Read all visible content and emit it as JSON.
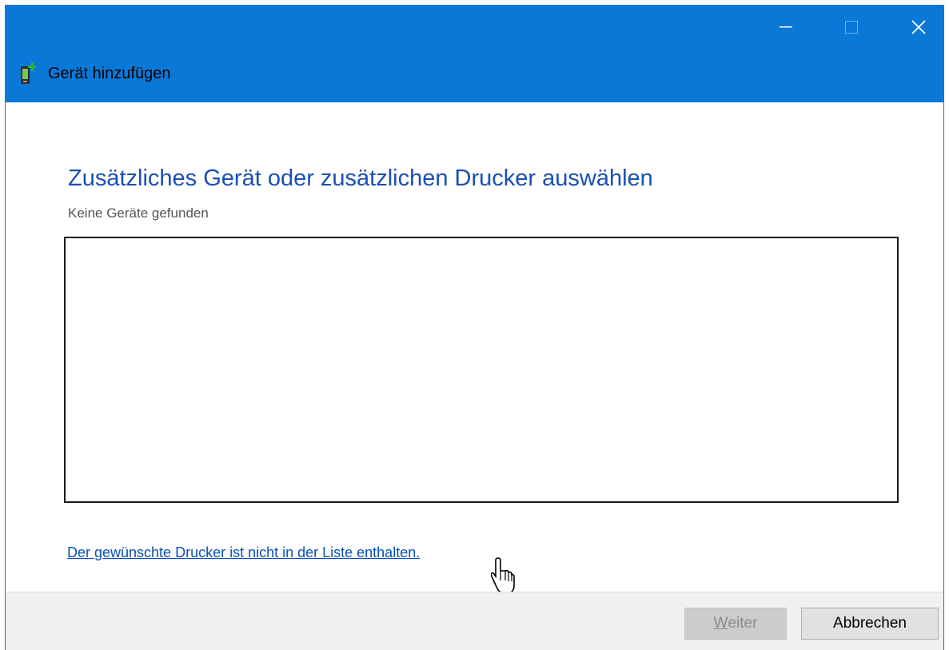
{
  "window": {
    "title": "Gerät hinzufügen",
    "accent_color": "#0a78d7",
    "caption_buttons": {
      "minimize_icon": "minimize-icon",
      "maximize_icon": "maximize-icon",
      "close_icon": "close-icon"
    }
  },
  "main": {
    "heading": "Zusätzliches Gerät oder zusätzlichen Drucker auswählen",
    "status": "Keine Geräte gefunden",
    "device_list": [],
    "printer_link": "Der gewünschte Drucker ist nicht in der Liste enthalten."
  },
  "footer": {
    "next_mnemonic": "W",
    "next_rest": "eiter",
    "cancel_label": "Abbrechen"
  }
}
